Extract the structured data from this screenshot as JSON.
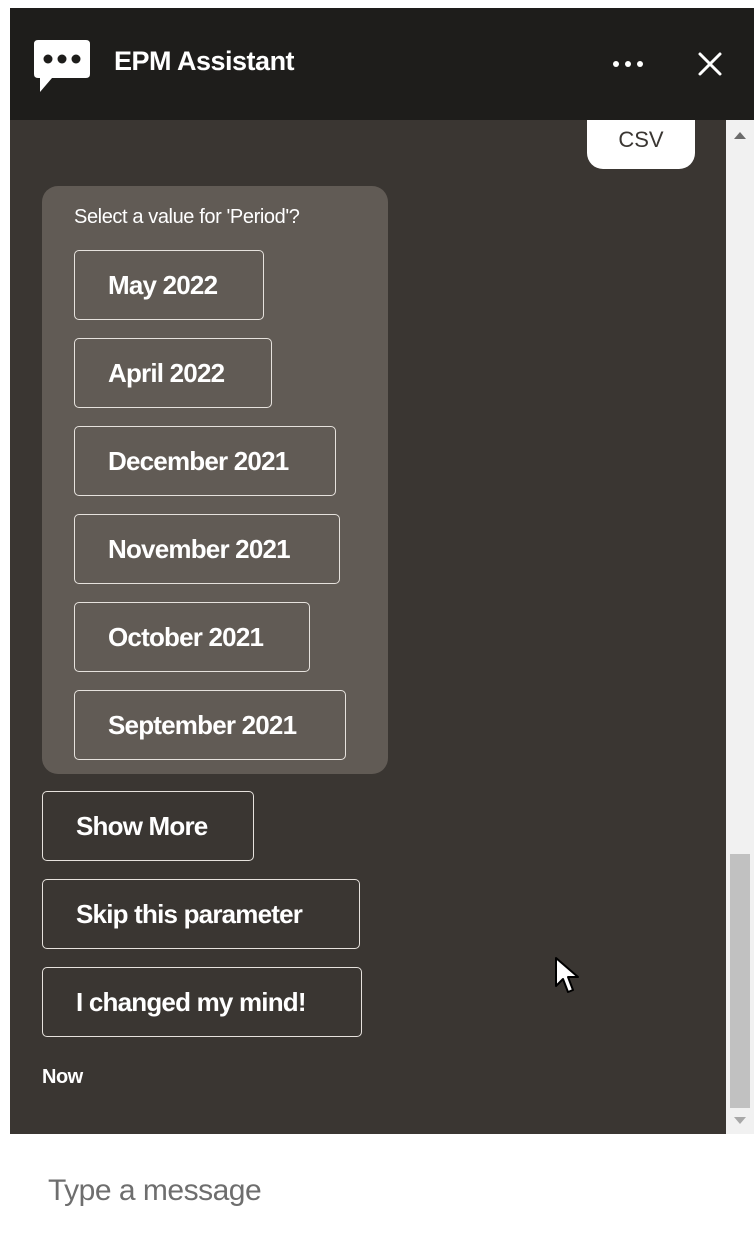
{
  "header": {
    "title": "EPM Assistant",
    "logo_icon": "chat-bubble-dots-icon",
    "more_icon": "more-horizontal-icon",
    "close_icon": "close-icon"
  },
  "conversation": {
    "user_message": "CSV",
    "bot_prompt": "Select a value for 'Period'?",
    "period_options": [
      "May 2022",
      "April 2022",
      "December 2021",
      "November 2021",
      "October 2021",
      "September 2021"
    ],
    "actions": [
      "Show More",
      "Skip this parameter",
      "I changed my mind!"
    ],
    "timestamp": "Now"
  },
  "composer": {
    "placeholder": "Type a message"
  },
  "colors": {
    "header_bg": "#1e1d1b",
    "conversation_bg": "#3a3632",
    "card_bg": "#615b55",
    "button_border": "#e6e2dd"
  }
}
